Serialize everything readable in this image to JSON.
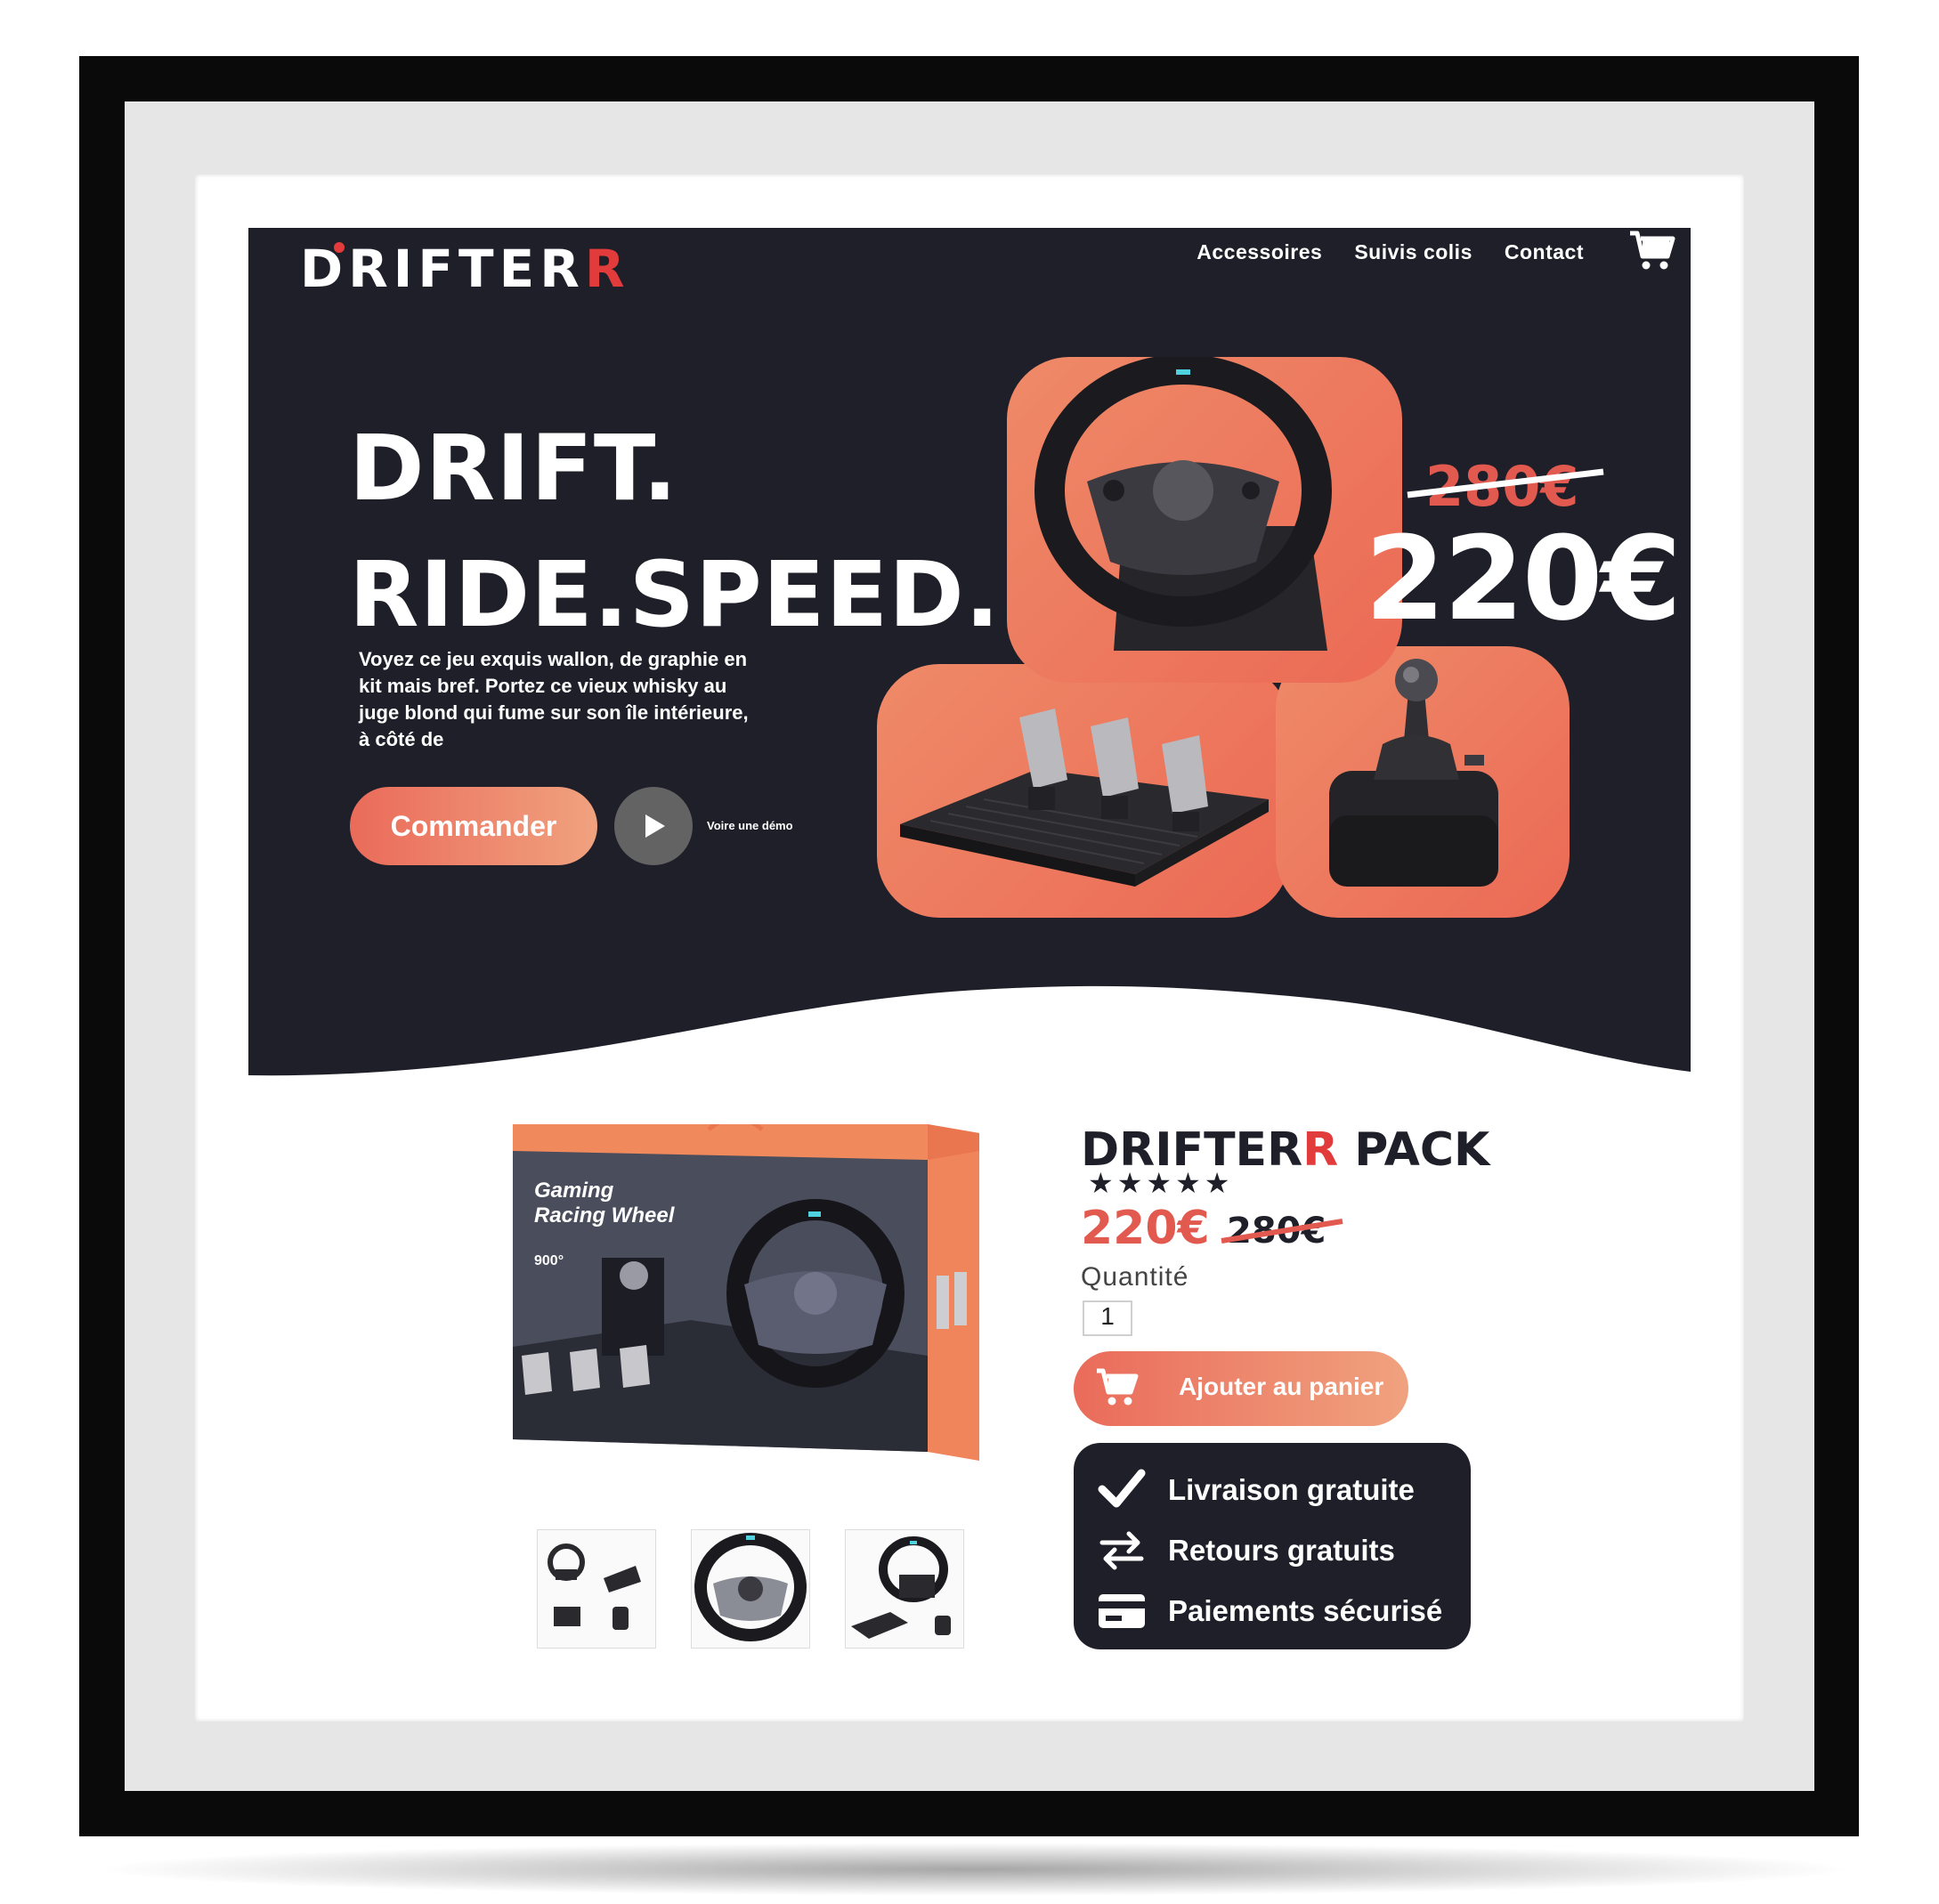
{
  "brand": {
    "logo_main": "DRIFTER",
    "logo_accent": "R",
    "accent_color": "#e23b3b",
    "dark_color": "#1f1f2a",
    "gradient_colors": [
      "#ea6b5a",
      "#f0a27f"
    ]
  },
  "nav": {
    "items": [
      "Accessoires",
      "Suivis colis",
      "Contact"
    ],
    "cart_icon": "cart-icon"
  },
  "hero": {
    "headline_line1": "DRIFT.",
    "headline_line2": "RIDE.SPEED.",
    "description": "Voyez ce jeu exquis wallon, de graphie en kit mais bref. Portez ce vieux whisky au juge blond qui fume sur son île intérieure, à côté de",
    "cta_label": "Commander",
    "demo_label": "Voire une démo",
    "old_price": "280€",
    "new_price": "220€",
    "tiles": [
      "steering-wheel-image",
      "pedals-image",
      "gear-shifter-image"
    ]
  },
  "product": {
    "title_main": "DRIFTER",
    "title_accent": "R",
    "title_suffix": " PACK",
    "stars": "★★★★★",
    "price": "220€",
    "old_price": "280€",
    "quantity_label": "Quantité",
    "quantity_value": "1",
    "add_to_cart_label": "Ajouter au panier",
    "box_text_line1": "Gaming",
    "box_text_line2": "Racing Wheel",
    "box_text_line3": "900°",
    "perks": [
      {
        "icon": "check-icon",
        "label": "Livraison gratuite"
      },
      {
        "icon": "exchange-arrows-icon",
        "label": "Retours gratuits"
      },
      {
        "icon": "credit-card-icon",
        "label": "Paiements sécurisé"
      }
    ],
    "thumbnails": [
      "thumbnail-set-overview",
      "thumbnail-wheel-front",
      "thumbnail-wheel-with-pedals"
    ]
  }
}
